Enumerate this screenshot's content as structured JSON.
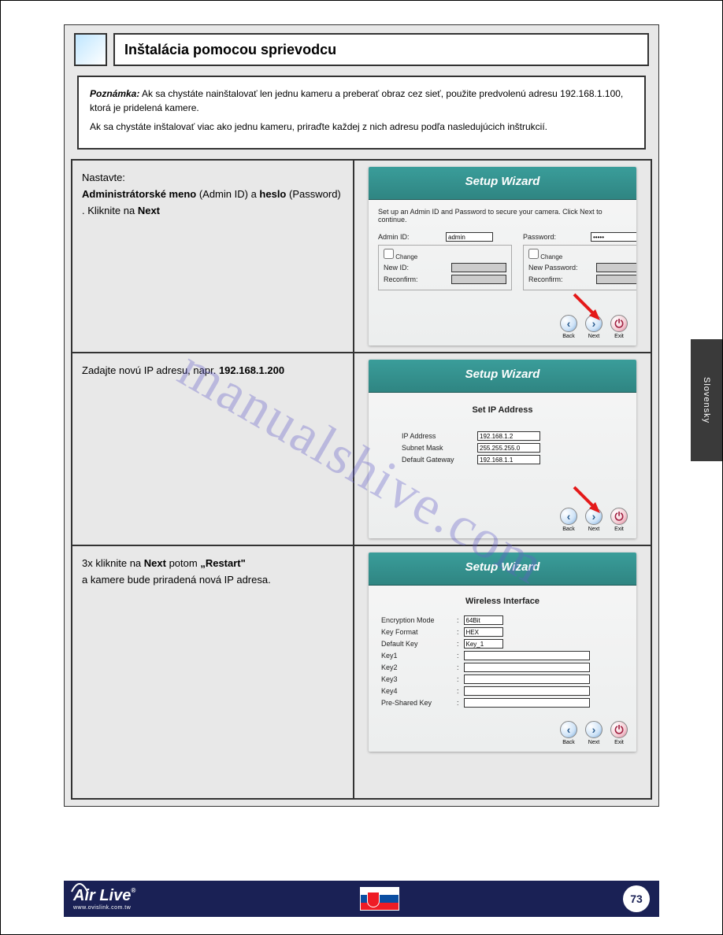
{
  "title": "Inštalácia pomocou sprievodcu",
  "note": {
    "label": "Poznámka:",
    "l1": "Ak sa chystáte nainštalovať len jednu kameru a preberať obraz cez sieť, použite predvolenú adresu 192.168.1.100, ktorá je pridelená kamere.",
    "l2": "Ak sa chystáte inštalovať viac ako jednu kameru, priraďte každej z nich adresu podľa nasledujúcich inštrukcií."
  },
  "steps": [
    {
      "txt1": "Nastavte:",
      "txt2": "Administrátorské meno",
      "txt3": "(Admin ID)",
      "txt4": " a ",
      "txt5": "heslo",
      "txt6": "(Password)",
      "txt7": ". Kliknite na ",
      "txt8": "Next"
    },
    {
      "txt1": "Zadajte novú IP adresu, napr. ",
      "txt2": "192.168.1.200"
    },
    {
      "txt1": "3x kliknite na ",
      "txt2": "Next",
      "txt3": " potom ",
      "txt4": "„Restart\"",
      "txt5": "a kamere bude priradená nová IP adresa."
    }
  ],
  "wizard1": {
    "title": "Setup Wizard",
    "intro": "Set up an Admin ID and Password to secure your camera. Click Next to continue.",
    "adminId": "Admin ID:",
    "adminIdVal": "admin",
    "password": "Password:",
    "passwordVal": "•••••",
    "change": "Change",
    "newId": "New ID:",
    "reconfirm": "Reconfirm:",
    "newPwd": "New Password:"
  },
  "wizard2": {
    "title": "Setup Wizard",
    "sub": "Set IP Address",
    "ip": "IP Address",
    "ipVal": "192.168.1.2",
    "mask": "Subnet Mask",
    "maskVal": "255.255.255.0",
    "gw": "Default Gateway",
    "gwVal": "192.168.1.1"
  },
  "wizard3": {
    "title": "Setup Wizard",
    "sub": "Wireless Interface",
    "enc": "Encryption Mode",
    "encVal": "64Bit",
    "fmt": "Key Format",
    "fmtVal": "HEX",
    "def": "Default Key",
    "defVal": "Key_1",
    "k1": "Key1",
    "k2": "Key2",
    "k3": "Key3",
    "k4": "Key4",
    "psk": "Pre-Shared Key"
  },
  "buttons": {
    "back": "Back",
    "next": "Next",
    "exit": "Exit"
  },
  "sideTab": "Slovensky",
  "footer": {
    "brand": "Air Live",
    "sub": "www.ovislink.com.tw",
    "page": "73"
  },
  "watermark": "manualshive.com"
}
